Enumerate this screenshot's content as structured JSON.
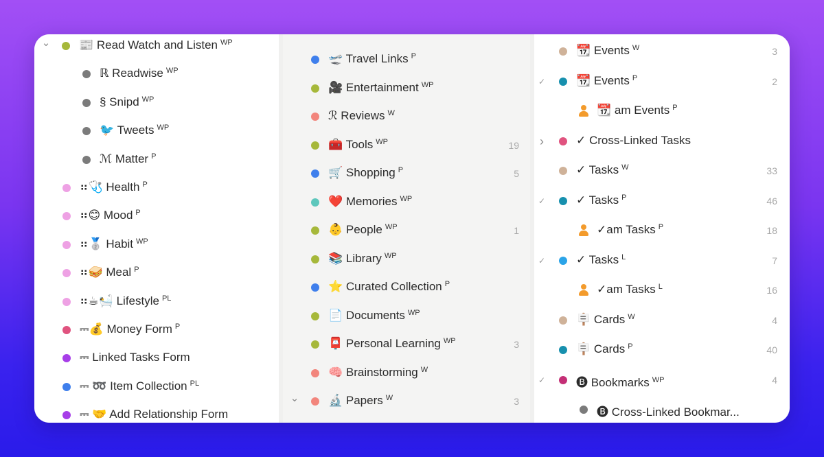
{
  "colors": {
    "olive": "#a6b83a",
    "gray": "#7b7b7b",
    "pink": "#eea1e4",
    "magenta": "#e0537f",
    "purple": "#a73ee8",
    "blue": "#3f7fec",
    "salmon": "#f2857c",
    "teal": "#5dc7bc",
    "tan": "#cfb299",
    "cyan": "#1790ae",
    "sky": "#2ba4e8",
    "raspberry": "#c42f76",
    "orange": "#f39b2c"
  },
  "col1": {
    "items": [
      {
        "icon": "newspaper-icon",
        "label": "📰 Read Watch and Listen",
        "sup": "WP"
      },
      {
        "icon": "readwise-icon",
        "label": "ℝ Readwise",
        "sup": "WP"
      },
      {
        "icon": "section-icon",
        "label": "§ Snipd",
        "sup": "WP"
      },
      {
        "icon": "bird-icon",
        "label": "🐦 Tweets",
        "sup": "WP"
      },
      {
        "icon": "matter-icon",
        "label": "ℳ Matter",
        "sup": "P"
      },
      {
        "icon": "stethoscope-icon",
        "label": "⠶🩺 Health",
        "sup": "P"
      },
      {
        "icon": "face-icon",
        "label": "⠶😊 Mood",
        "sup": "P"
      },
      {
        "icon": "medal-icon",
        "label": "⠶🥈 Habit",
        "sup": "WP"
      },
      {
        "icon": "bread-icon",
        "label": "⠶🥪 Meal",
        "sup": "P"
      },
      {
        "icon": "coffee-icon",
        "label": "⠶☕🛀 Lifestyle",
        "sup": "PL"
      },
      {
        "icon": "money-bag-icon",
        "label": "⎓💰 Money Form",
        "sup": "P"
      },
      {
        "icon": "form-icon",
        "label": "⎓ Linked Tasks Form",
        "sup": ""
      },
      {
        "icon": "infinity-icon",
        "label": "⎓ ➿ Item Collection",
        "sup": "PL"
      },
      {
        "icon": "handshake-icon",
        "label": "⎓ 🤝 Add Relationship Form",
        "sup": ""
      }
    ]
  },
  "col2": {
    "items": [
      {
        "icon": "airplane-icon",
        "label": "🛫 Travel Links",
        "sup": "P",
        "count": ""
      },
      {
        "icon": "camera-icon",
        "label": "🎥 Entertainment",
        "sup": "WP",
        "count": ""
      },
      {
        "icon": "script-r-icon",
        "label": "ℛ Reviews",
        "sup": "W",
        "count": ""
      },
      {
        "icon": "toolbox-icon",
        "label": "🧰 Tools",
        "sup": "WP",
        "count": "19"
      },
      {
        "icon": "cart-icon",
        "label": "🛒 Shopping",
        "sup": "P",
        "count": "5"
      },
      {
        "icon": "heart-icon",
        "label": "❤️ Memories",
        "sup": "WP",
        "count": ""
      },
      {
        "icon": "person-icon",
        "label": "👶 People",
        "sup": "WP",
        "count": "1"
      },
      {
        "icon": "books-icon",
        "label": "📚 Library",
        "sup": "WP",
        "count": ""
      },
      {
        "icon": "star-icon",
        "label": "⭐ Curated Collection",
        "sup": "P",
        "count": ""
      },
      {
        "icon": "document-icon",
        "label": "📄 Documents",
        "sup": "WP",
        "count": ""
      },
      {
        "icon": "mailbox-icon",
        "label": "📮 Personal Learning",
        "sup": "WP",
        "count": "3"
      },
      {
        "icon": "brain-icon",
        "label": "🧠 Brainstorming",
        "sup": "W",
        "count": ""
      },
      {
        "icon": "microscope-icon",
        "label": "🔬 Papers",
        "sup": "W",
        "count": "3"
      }
    ]
  },
  "col3": {
    "items": [
      {
        "icon": "calendar-icon",
        "label": "📆 Events",
        "sup": "W",
        "count": "3"
      },
      {
        "icon": "calendar-icon",
        "label": "📆 Events",
        "sup": "P",
        "count": "2"
      },
      {
        "icon": "calendar-icon",
        "label": "📆 am Events",
        "sup": "P",
        "count": ""
      },
      {
        "icon": "checkmark-icon",
        "label": "✓ Cross-Linked Tasks",
        "sup": "",
        "count": ""
      },
      {
        "icon": "checkmark-icon",
        "label": "✓ Tasks",
        "sup": "W",
        "count": "33"
      },
      {
        "icon": "checkmark-icon",
        "label": "✓ Tasks",
        "sup": "P",
        "count": "46"
      },
      {
        "icon": "checkmark-icon",
        "label": "✓am Tasks",
        "sup": "P",
        "count": "18"
      },
      {
        "icon": "checkmark-icon",
        "label": "✓ Tasks",
        "sup": "L",
        "count": "7"
      },
      {
        "icon": "checkmark-icon",
        "label": "✓am Tasks",
        "sup": "L",
        "count": "16"
      },
      {
        "icon": "placard-icon",
        "label": "🪧 Cards",
        "sup": "W",
        "count": "4"
      },
      {
        "icon": "placard-icon",
        "label": "🪧 Cards",
        "sup": "P",
        "count": "40"
      },
      {
        "icon": "bookmark-b-icon",
        "label": "🅑 Bookmarks",
        "sup": "WP",
        "count": "4"
      },
      {
        "icon": "bookmark-b-icon",
        "label": "🅑 Cross-Linked Bookmar...",
        "sup": "",
        "count": ""
      }
    ]
  }
}
